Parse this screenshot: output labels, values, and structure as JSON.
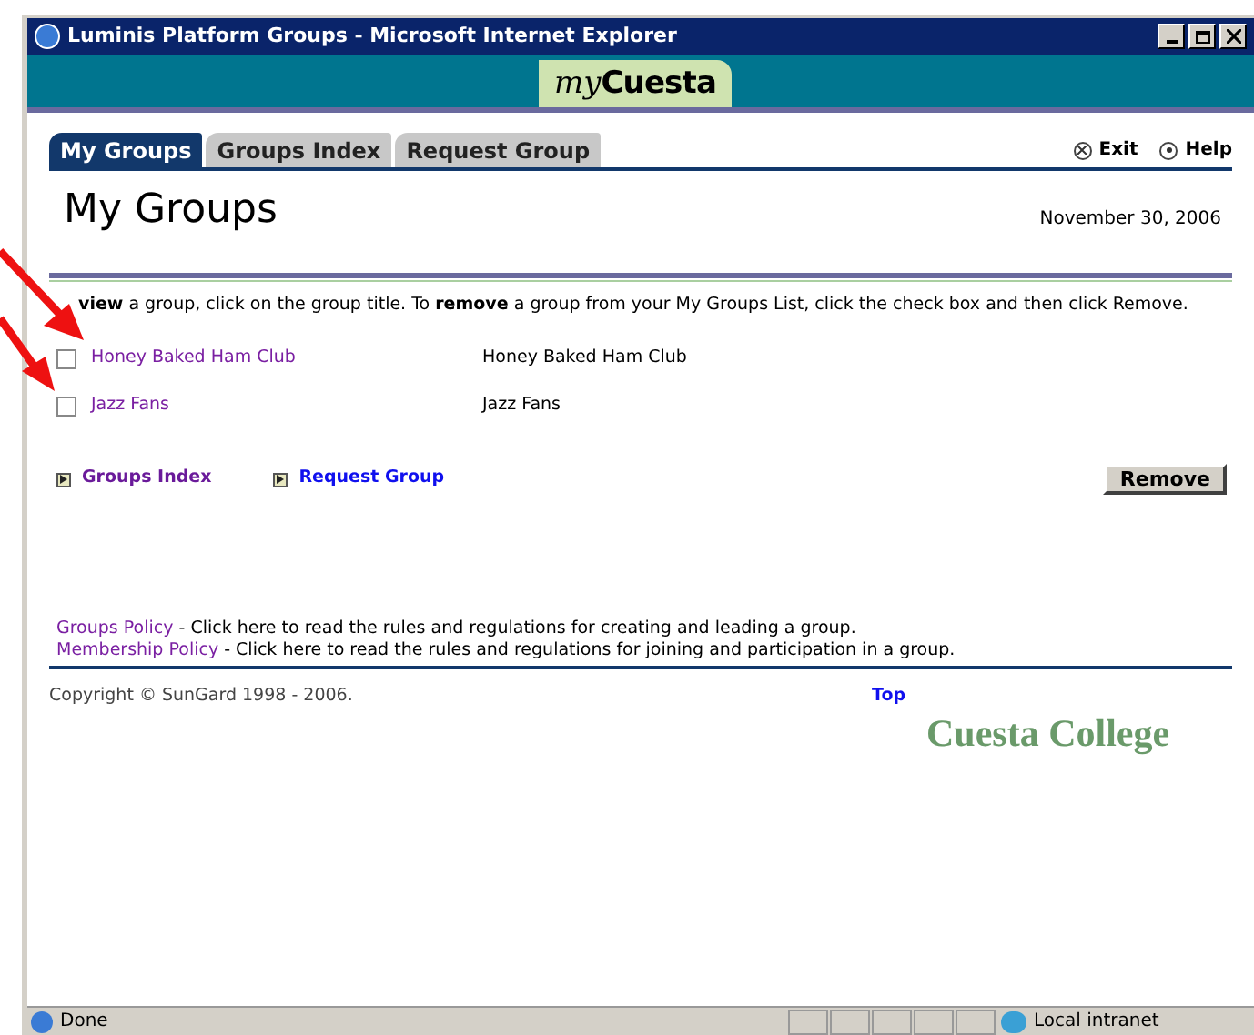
{
  "window": {
    "title": "Luminis Platform Groups - Microsoft Internet Explorer"
  },
  "banner": {
    "logo_prefix": "my",
    "logo_name": "Cuesta"
  },
  "tabs": [
    {
      "label": "My Groups",
      "selected": true
    },
    {
      "label": "Groups Index",
      "selected": false
    },
    {
      "label": "Request Group",
      "selected": false
    }
  ],
  "header_links": [
    "Exit",
    "Help"
  ],
  "page_title": "My Groups",
  "date": "November 30, 2006",
  "instructions": "**view** a group, click on the group title. To **remove** a group from your My Groups List, click the check box and then click Remove.",
  "groups": [
    {
      "name": "Honey Baked Ham Club",
      "description": "Honey Baked Ham Club",
      "checked": false
    },
    {
      "name": "Jazz Fans",
      "description": "Jazz Fans",
      "checked": false
    }
  ],
  "nav_links": [
    {
      "label": "Groups Index",
      "visited": true
    },
    {
      "label": "Request Group",
      "visited": false
    }
  ],
  "remove_button": "Remove",
  "policies": [
    {
      "link": "Groups Policy",
      "text": "- Click here to read the rules and regulations for creating and leading a group."
    },
    {
      "link": "Membership Policy",
      "text": "- Click here to read the rules and regulations for joining and participation in a group."
    }
  ],
  "copyright": "Copyright © SunGard 1998 - 2006.",
  "top_link": "Top",
  "college_name": "Cuesta College",
  "status_bar": {
    "status": "Done",
    "zone": "Local intranet"
  }
}
